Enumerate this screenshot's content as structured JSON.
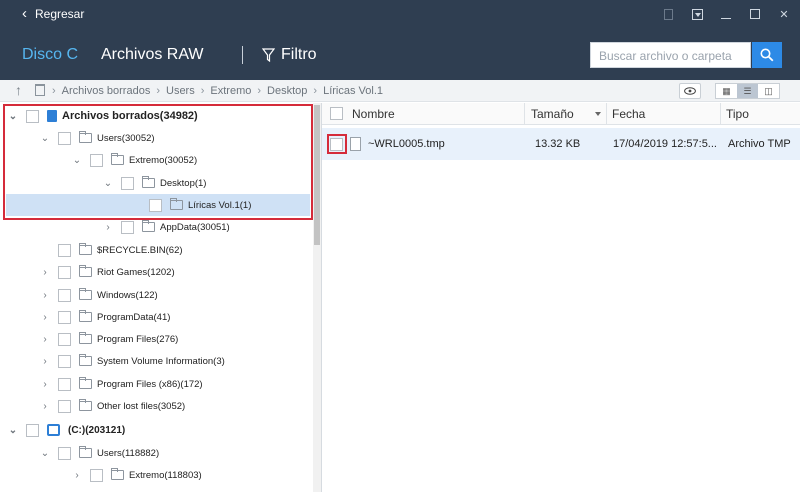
{
  "titlebar": {
    "back_label": "Regresar"
  },
  "navbar": {
    "tab_disk": "Disco C",
    "tab_raw": "Archivos RAW",
    "filter_label": "Filtro",
    "search_placeholder": "Buscar archivo o carpeta"
  },
  "breadcrumb": [
    "Archivos borrados",
    "Users",
    "Extremo",
    "Desktop",
    "Líricas Vol.1"
  ],
  "tree": [
    {
      "label": "Archivos borrados(34982)"
    },
    {
      "label": "Users(30052)"
    },
    {
      "label": "Extremo(30052)"
    },
    {
      "label": "Desktop(1)"
    },
    {
      "label": "Líricas Vol.1(1)"
    },
    {
      "label": "AppData(30051)"
    },
    {
      "label": "$RECYCLE.BIN(62)"
    },
    {
      "label": "Riot Games(1202)"
    },
    {
      "label": "Windows(122)"
    },
    {
      "label": "ProgramData(41)"
    },
    {
      "label": "Program Files(276)"
    },
    {
      "label": "System Volume Information(3)"
    },
    {
      "label": "Program Files (x86)(172)"
    },
    {
      "label": "Other lost files(3052)"
    },
    {
      "label": "(C:)(203121)"
    },
    {
      "label": "Users(118882)"
    },
    {
      "label": "Extremo(118803)"
    }
  ],
  "table": {
    "columns": {
      "name": "Nombre",
      "size": "Tamaño",
      "date": "Fecha",
      "type": "Tipo"
    },
    "rows": [
      {
        "name": "~WRL0005.tmp",
        "size": "13.32 KB",
        "date": "17/04/2019 12:57:5...",
        "type": "Archivo TMP"
      }
    ]
  }
}
